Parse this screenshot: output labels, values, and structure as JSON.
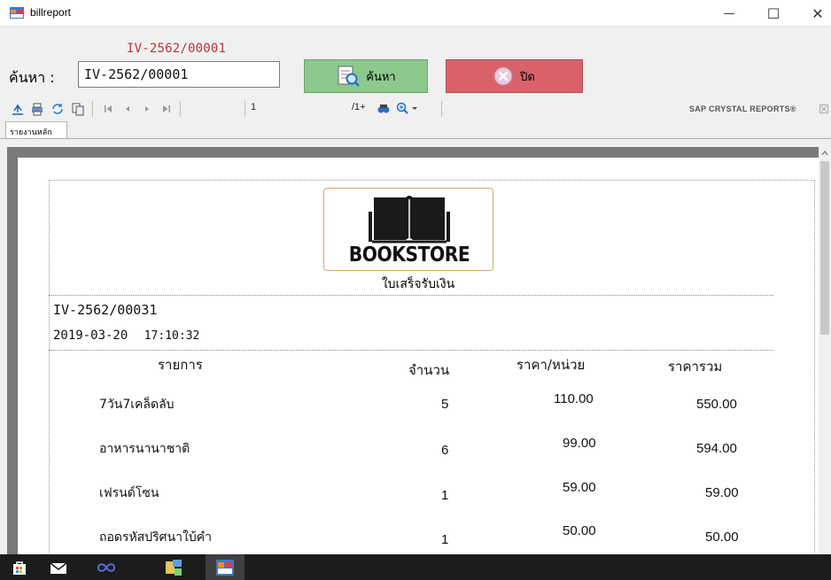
{
  "window": {
    "title": "billreport",
    "minimize_glyph": "—",
    "maximize_glyph": "☐",
    "close_glyph": "✕"
  },
  "search": {
    "hint": "IV-2562/00001",
    "label": "ค้นหา :",
    "value": "IV-2562/00001",
    "search_button": "ค้นหา",
    "close_button": "ปิด"
  },
  "toolbar": {
    "icons": [
      "export-icon",
      "print-icon",
      "refresh-icon",
      "copy-icon",
      "first-page-icon",
      "prev-page-icon",
      "next-page-icon",
      "last-page-icon",
      "find-icon",
      "zoom-icon"
    ],
    "current_page": "1",
    "total_pages": "/1+",
    "brand": "SAP CRYSTAL REPORTS®"
  },
  "tab": {
    "label": "รายงานหลัก"
  },
  "report": {
    "logo_text": "BOOKSTORE",
    "title": "ใบเสร็จรับเงิน",
    "bill_no": "IV-2562/00031",
    "date": "2019-03-20",
    "time": "17:10:32",
    "columns": {
      "item": "รายการ",
      "qty": "จำนวน",
      "unit_price": "ราคา/หน่วย",
      "total": "ราคารวม"
    },
    "rows": [
      {
        "item": "7วัน7เคล็ดลับ",
        "qty": "5",
        "unit_price": "110.00",
        "total": "550.00"
      },
      {
        "item": "อาหารนานาชาติ",
        "qty": "6",
        "unit_price": "99.00",
        "total": "594.00"
      },
      {
        "item": "เฟรนด์โซน",
        "qty": "1",
        "unit_price": "59.00",
        "total": "59.00"
      },
      {
        "item": "ถอดรหัสปริศนาใบ้คำ",
        "qty": "1",
        "unit_price": "50.00",
        "total": "50.00"
      }
    ]
  },
  "colors": {
    "search_button": "#8dc88d",
    "close_button": "#d9626a",
    "hint_text": "#b5343a",
    "taskbar": "#1c1c1c"
  }
}
